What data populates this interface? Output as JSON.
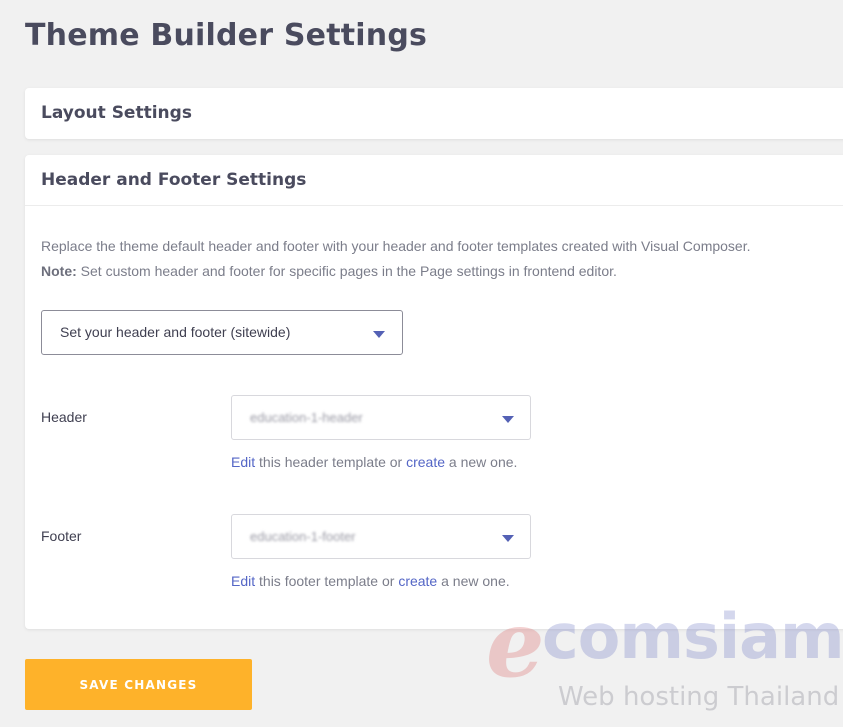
{
  "page": {
    "title": "Theme Builder Settings"
  },
  "layout_panel": {
    "heading": "Layout Settings"
  },
  "header_footer_panel": {
    "heading": "Header and Footer Settings",
    "description": "Replace the theme default header and footer with your header and footer templates created with Visual Composer.",
    "note_label": "Note:",
    "note_text": " Set custom header and footer for specific pages in the Page settings in frontend editor.",
    "scope_select": {
      "value": "Set your header and footer (sitewide)"
    },
    "header": {
      "label": "Header",
      "select_value": "education-1-header",
      "edit_link": "Edit",
      "mid_text": " this header template or ",
      "create_link": "create",
      "end_text": " a new one."
    },
    "footer": {
      "label": "Footer",
      "select_value": "education-1-footer",
      "edit_link": "Edit",
      "mid_text": " this footer template or ",
      "create_link": "create",
      "end_text": " a new one."
    }
  },
  "actions": {
    "save_label": "SAVE CHANGES"
  },
  "watermark": {
    "mark": "e",
    "brand": "comsiam",
    "tagline": "Web hosting Thailand"
  },
  "colors": {
    "accent": "#feb22a",
    "link": "#5466c6",
    "caret": "#5461b5",
    "background": "#f1f1f1"
  }
}
